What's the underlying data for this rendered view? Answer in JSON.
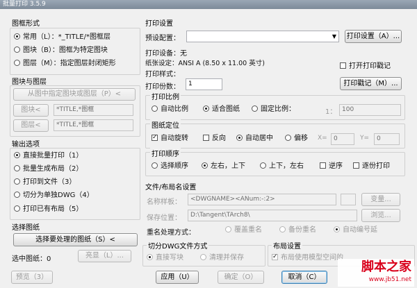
{
  "window": {
    "title": "批量打印 3.5.9"
  },
  "frame_form": {
    "section": "图框形式",
    "options": [
      {
        "label": "常用（L）：*_TITLE/*图框层",
        "selected": true
      },
      {
        "label": "图块（B）：图框为特定图块",
        "selected": false
      },
      {
        "label": "图层（M）：指定图层封闭矩形",
        "selected": false
      }
    ]
  },
  "block_layer": {
    "section": "图块与图层",
    "pick_button": "从图中指定图块或图层（P）<",
    "block_button": "图块<",
    "block_value": "*TITLE,*图框",
    "layer_button": "图层<",
    "layer_value": "*TITLE,*图框"
  },
  "output": {
    "section": "输出选项",
    "options": [
      {
        "label": "直接批量打印（1）",
        "selected": true
      },
      {
        "label": "批量生成布局（2）",
        "selected": false
      },
      {
        "label": "打印到文件（3）",
        "selected": false
      },
      {
        "label": "切分为单独DWG（4）",
        "selected": false
      },
      {
        "label": "打印已有布局（5）",
        "selected": false
      }
    ]
  },
  "select_drawings": {
    "section": "选择图纸",
    "button": "选择要处理的图纸（S）<",
    "count_label": "选中图纸：0",
    "highlight_button": "亮显（L）..."
  },
  "print_settings": {
    "section": "打印设置",
    "preset_label": "预设配置：",
    "preset_value": "",
    "settings_button": "打印设置（A）...",
    "device_label": "打印设备：无",
    "paper_label": "纸张设定：ANSI A (8.50 x 11.00 英寸)",
    "style_label": "打印样式：",
    "stamp_checkbox": "打开打印戳记",
    "stamp_checked": false,
    "copies_label": "打印份数：",
    "copies_value": "1",
    "stamp_button": "打印戳记（M）..."
  },
  "scale": {
    "section": "打印比例",
    "options": [
      {
        "label": "自动比例",
        "selected": false
      },
      {
        "label": "适合图纸",
        "selected": true
      },
      {
        "label": "固定比例：",
        "selected": false
      }
    ],
    "ratio_prefix": "1：",
    "ratio_value": "100"
  },
  "position": {
    "section": "图纸定位",
    "auto_rotate": "自动旋转",
    "auto_rotate_checked": true,
    "reverse": "反向",
    "reverse_checked": false,
    "center_label": "自动居中",
    "center_selected": true,
    "offset_label": "偏移",
    "offset_selected": false,
    "x_label": "X=",
    "x_value": "0",
    "y_label": "Y=",
    "y_value": "0"
  },
  "order": {
    "section": "打印顺序",
    "options": [
      {
        "label": "选择顺序",
        "selected": false
      },
      {
        "label": "左右，上下",
        "selected": true
      },
      {
        "label": "上下，左右",
        "selected": false
      }
    ],
    "reverse": "逆序",
    "reverse_checked": false,
    "copy_by_copy": "逐份打印",
    "copy_by_copy_checked": false
  },
  "file_naming": {
    "section": "文件/布局名设置",
    "name_label": "名称样板：",
    "name_value": "<DWGNAME><ANum:-:2>",
    "change_button": "变量...",
    "save_label": "保存位置：",
    "save_value": "D:\\Tangent\\TArch8\\",
    "browse_button": "浏览...",
    "duplicate_label": "重名处理方式：",
    "duplicate_options": [
      {
        "label": "覆盖重名",
        "selected": false
      },
      {
        "label": "备份重名",
        "selected": false
      },
      {
        "label": "自动编号延",
        "selected": true
      }
    ]
  },
  "split_dwg": {
    "section": "切分DWG文件方式",
    "options": [
      {
        "label": "直接写块",
        "selected": true
      },
      {
        "label": "清理并保存",
        "selected": false
      }
    ]
  },
  "layout_settings": {
    "section": "布局设置",
    "checkbox": "布局使用模型空间的",
    "checked": true
  },
  "footer": {
    "preview_button": "预览（3）",
    "apply_button": "应用（U）",
    "ok_button": "确定（O）",
    "cancel_button": "取消（C）"
  },
  "watermark": {
    "title": "脚本之家",
    "url": "www.jb51.net",
    "color": "#d9001b"
  }
}
